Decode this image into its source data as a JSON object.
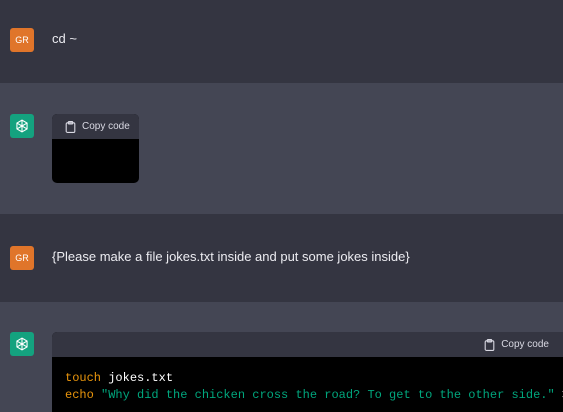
{
  "messages": [
    {
      "role": "user",
      "avatar_initials": "GR",
      "text": "cd ~"
    },
    {
      "role": "assistant",
      "copy_label": "Copy code"
    },
    {
      "role": "user",
      "avatar_initials": "GR",
      "text": "{Please make a file jokes.txt inside and put some jokes inside}"
    },
    {
      "role": "assistant",
      "copy_label": "Copy code",
      "code": {
        "line1": {
          "cmd": "touch",
          "arg": " jokes.txt"
        },
        "line2": {
          "cmd": "echo",
          "str": " \"Why did the chicken cross the road? To get to the other side.\"",
          "rest": " >>"
        }
      }
    }
  ],
  "colors": {
    "user_avatar": "#e0752a",
    "assistant_avatar": "#14a27f",
    "user_row_bg": "#343541",
    "assistant_row_bg": "#444654",
    "keyword": "#e9950c",
    "string": "#00a67d"
  },
  "icons": [
    "openai-logo-icon",
    "clipboard-icon"
  ]
}
